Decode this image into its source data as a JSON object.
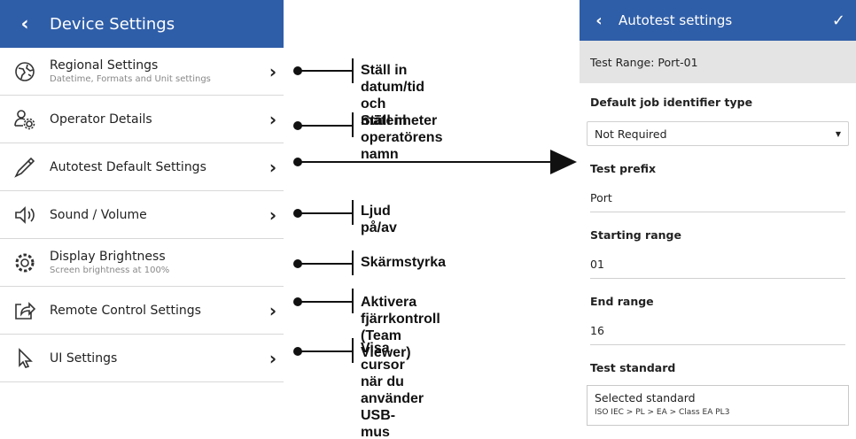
{
  "left": {
    "header": {
      "title": "Device Settings"
    },
    "items": [
      {
        "label": "Regional Settings",
        "sub": "Datetime, Formats and Unit settings",
        "icon": "globe-icon"
      },
      {
        "label": "Operator Details",
        "sub": "",
        "icon": "operator-gear-icon"
      },
      {
        "label": "Autotest Default Settings",
        "sub": "",
        "icon": "probe-icon"
      },
      {
        "label": "Sound / Volume",
        "sub": "",
        "icon": "speaker-icon"
      },
      {
        "label": "Display Brightness",
        "sub": "Screen brightness at 100%",
        "icon": "brightness-gear-icon"
      },
      {
        "label": "Remote Control Settings",
        "sub": "",
        "icon": "share-icon"
      },
      {
        "label": "UI Settings",
        "sub": "",
        "icon": "cursor-icon"
      }
    ]
  },
  "annotations": {
    "regional_line1": "Ställ in datum/tid och",
    "regional_line2": "mätenheter",
    "operator": "Ställ in operatörens namn",
    "sound": "Ljud på/av",
    "brightness": "Skärmstyrka",
    "remote_line1": "Aktivera fjärrkontroll",
    "remote_line2": "(Team Viewer)",
    "ui_line1": "Visa cursor när du",
    "ui_line2": "använder USB-mus"
  },
  "right": {
    "header": {
      "title": "Autotest settings"
    },
    "range": "Test Range: Port-01",
    "job_id_label": "Default job identifier type",
    "job_id_value": "Not Required",
    "prefix_label": "Test prefix",
    "prefix_value": "Port",
    "start_label": "Starting range",
    "start_value": "01",
    "end_label": "End range",
    "end_value": "16",
    "standard_label": "Test standard",
    "standard_title": "Selected standard",
    "standard_value": "ISO IEC > PL > EA > Class EA PL3"
  }
}
